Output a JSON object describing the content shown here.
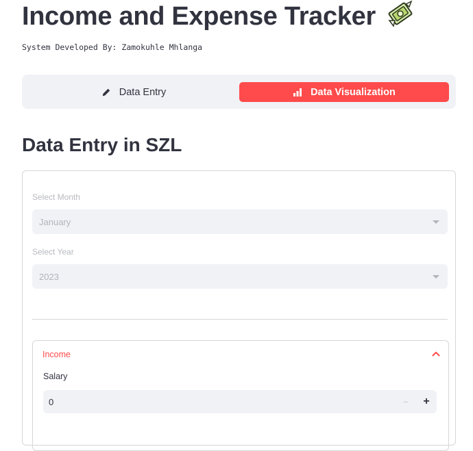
{
  "header": {
    "title": "Income and Expense Tracker",
    "icon": "money-with-wings-icon",
    "subtitle": "System Developed By: Zamokuhle Mhlanga"
  },
  "nav": {
    "items": [
      {
        "label": "Data Entry",
        "icon": "pencil-icon",
        "active": false
      },
      {
        "label": "Data Visualization",
        "icon": "bar-chart-icon",
        "active": true
      }
    ],
    "active_color": "#ff4b4b"
  },
  "section": {
    "title": "Data Entry in SZL"
  },
  "form": {
    "month": {
      "label": "Select Month",
      "value": "January"
    },
    "year": {
      "label": "Select Year",
      "value": "2023"
    },
    "income": {
      "title": "Income",
      "expanded": true,
      "salary": {
        "label": "Salary",
        "value": "0",
        "minus": "−",
        "plus": "+"
      }
    }
  }
}
